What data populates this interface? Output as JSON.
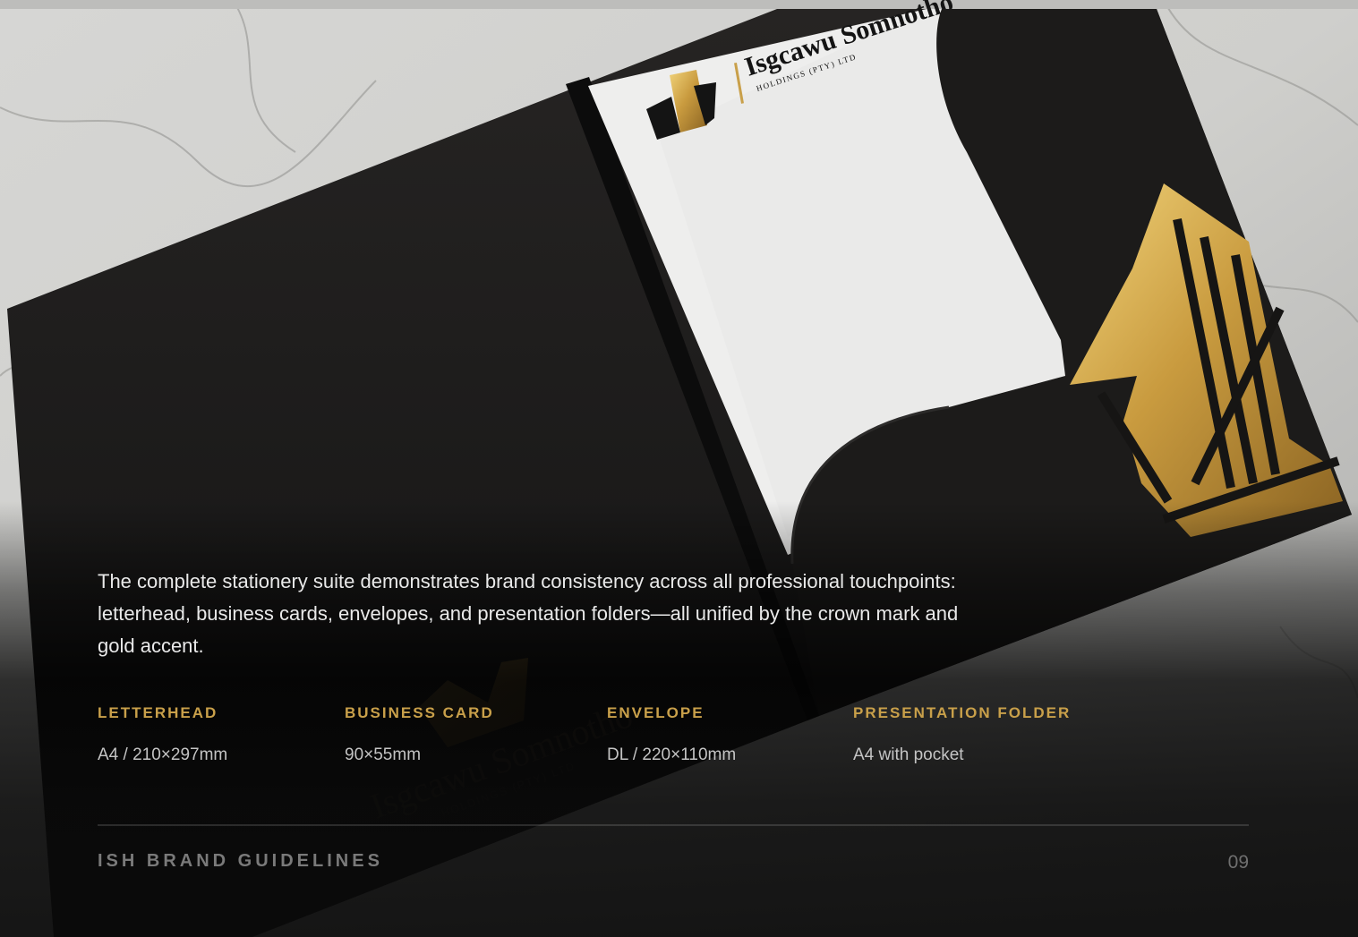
{
  "brand": {
    "name": "Isgcawu Somnotho",
    "subtitle": "HOLDINGS (PTY) LTD",
    "gold": "#c9a04a"
  },
  "description": "The complete stationery suite demonstrates brand consistency across all professional touchpoints: letterhead, business cards, envelopes, and presentation folders—all unified by the crown mark and gold accent.",
  "specs": [
    {
      "label": "LETTERHEAD",
      "value": "A4 / 210×297mm"
    },
    {
      "label": "BUSINESS CARD",
      "value": "90×55mm"
    },
    {
      "label": "ENVELOPE",
      "value": "DL / 220×110mm"
    },
    {
      "label": "PRESENTATION FOLDER",
      "value": "A4 with pocket"
    }
  ],
  "footer": {
    "title": "ISH BRAND GUIDELINES",
    "page": "09"
  }
}
